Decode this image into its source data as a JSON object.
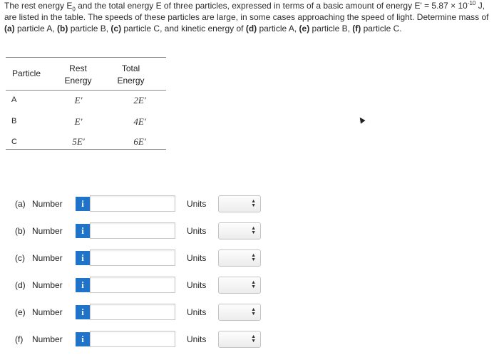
{
  "problem": {
    "text1": "The rest energy E",
    "sub0": "0",
    "text2": " and the total energy E of three particles, expressed in terms of a basic amount of energy E' = 5.87 × 10",
    "exp": "-10",
    "text3": " J, are listed in the table. The speeds of these particles are large, in some cases approaching the speed of light. Determine mass of ",
    "a": "(a)",
    "t_a": " particle A, ",
    "b": "(b)",
    "t_b": " particle B, ",
    "c": "(c)",
    "t_c": " particle C, and kinetic energy of ",
    "d": "(d)",
    "t_d": " particle A, ",
    "e": "(e)",
    "t_e": " particle B, ",
    "f": "(f)",
    "t_f": " particle C."
  },
  "table": {
    "headers": [
      "Particle",
      "Rest",
      "Energy",
      "Total",
      "Energy"
    ],
    "rows": [
      {
        "particle": "A",
        "rest": "E'",
        "total": "2E'"
      },
      {
        "particle": "B",
        "rest": "E'",
        "total": "4E'"
      },
      {
        "particle": "C",
        "rest": "5E'",
        "total": "6E'"
      }
    ]
  },
  "answers": [
    {
      "letter": "(a)",
      "label": "Number",
      "info": "i",
      "value": "",
      "units_label": "Units"
    },
    {
      "letter": "(b)",
      "label": "Number",
      "info": "i",
      "value": "",
      "units_label": "Units"
    },
    {
      "letter": "(c)",
      "label": "Number",
      "info": "i",
      "value": "",
      "units_label": "Units"
    },
    {
      "letter": "(d)",
      "label": "Number",
      "info": "i",
      "value": "",
      "units_label": "Units"
    },
    {
      "letter": "(e)",
      "label": "Number",
      "info": "i",
      "value": "",
      "units_label": "Units"
    },
    {
      "letter": "(f)",
      "label": "Number",
      "info": "i",
      "value": "",
      "units_label": "Units"
    }
  ],
  "colors": {
    "info_button": "#1f73c9",
    "rule": "#8a8a8a"
  },
  "icons": {
    "info": "info-icon",
    "select_arrows": "updown-arrows-icon",
    "cursor": "mouse-pointer-icon"
  }
}
